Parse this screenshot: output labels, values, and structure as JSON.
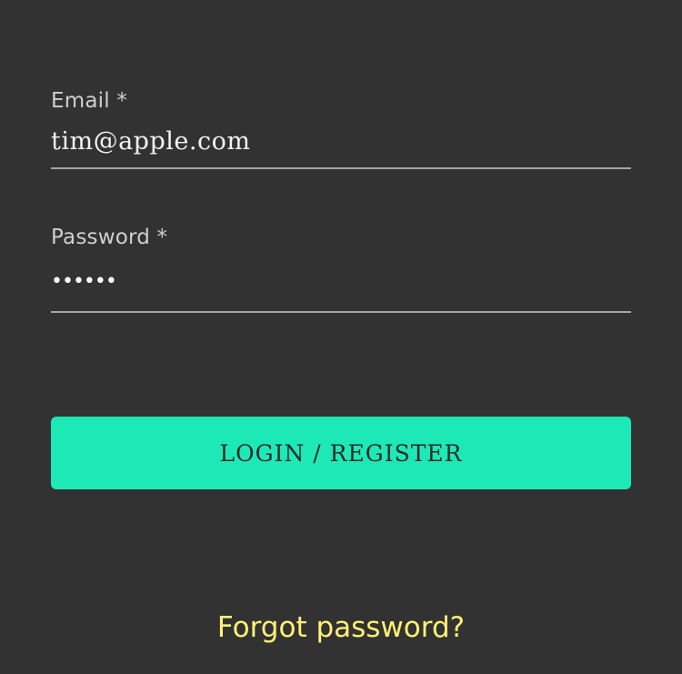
{
  "form": {
    "email": {
      "label": "Email *",
      "value": "tim@apple.com"
    },
    "password": {
      "label": "Password *",
      "value": "••••••"
    },
    "submit_label": "LOGIN / REGISTER",
    "forgot_label": "Forgot password?"
  },
  "colors": {
    "background": "#323232",
    "accent": "#1de9b6",
    "link": "#fff176"
  }
}
